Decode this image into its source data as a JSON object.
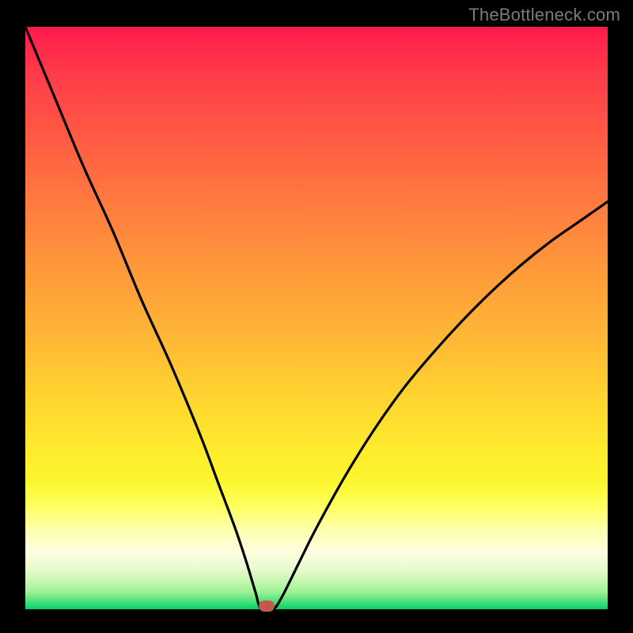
{
  "watermark": "TheBottleneck.com",
  "chart_data": {
    "type": "line",
    "title": "",
    "xlabel": "",
    "ylabel": "",
    "xlim": [
      0,
      100
    ],
    "ylim": [
      0,
      100
    ],
    "grid": false,
    "legend": false,
    "series": [
      {
        "name": "bottleneck-curve",
        "x": [
          0,
          5,
          10,
          15,
          20,
          25,
          30,
          33,
          36,
          38,
          39.5,
          40.5,
          42.5,
          44,
          47,
          50,
          55,
          60,
          65,
          70,
          75,
          80,
          85,
          90,
          95,
          100
        ],
        "y": [
          100,
          88,
          76,
          65,
          53,
          42,
          30,
          22,
          14,
          8,
          3,
          0,
          0,
          2,
          8,
          14,
          23,
          31,
          38,
          44,
          49.5,
          54.5,
          59,
          63,
          66.5,
          70
        ]
      }
    ],
    "marker": {
      "x": 41.5,
      "y": 0.6,
      "color": "#c1594f"
    },
    "background_gradient": {
      "top": "#ff1a4d",
      "mid": "#ffd530",
      "bottom": "#00d26a"
    }
  }
}
